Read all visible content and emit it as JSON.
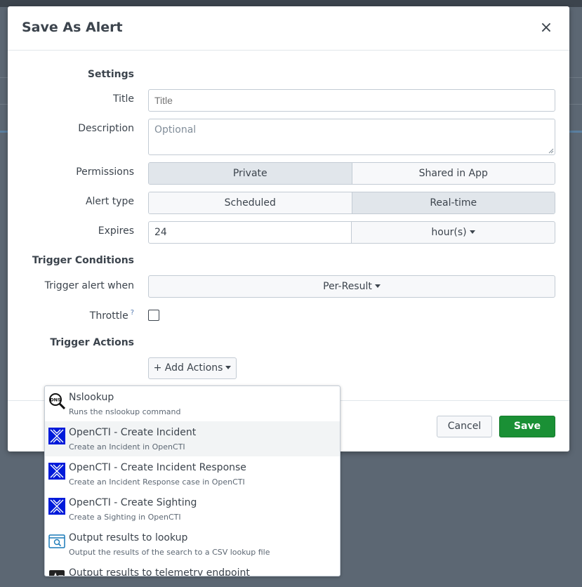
{
  "modal": {
    "title": "Save As Alert",
    "close_label": "×"
  },
  "settings": {
    "heading": "Settings",
    "title_label": "Title",
    "title_placeholder": "Title",
    "description_label": "Description",
    "description_placeholder": "Optional",
    "permissions_label": "Permissions",
    "permissions_options": [
      "Private",
      "Shared in App"
    ],
    "permissions_selected": "Private",
    "alert_type_label": "Alert type",
    "alert_type_options": [
      "Scheduled",
      "Real-time"
    ],
    "alert_type_selected": "Real-time",
    "expires_label": "Expires",
    "expires_value": "24",
    "expires_unit": "hour(s)"
  },
  "trigger_conditions": {
    "heading": "Trigger Conditions",
    "trigger_when_label": "Trigger alert when",
    "trigger_when_value": "Per-Result",
    "throttle_label": "Throttle",
    "throttle_help": "?",
    "throttle_checked": false
  },
  "trigger_actions": {
    "heading": "Trigger Actions",
    "add_actions_label": "+ Add Actions"
  },
  "footer": {
    "cancel_label": "Cancel",
    "save_label": "Save",
    "save_color": "#1a9035"
  },
  "actions_menu": {
    "items": [
      {
        "name": "Nslookup",
        "description": "Runs the nslookup command",
        "icon": "dns-magnifier-icon"
      },
      {
        "name": "OpenCTI - Create Incident",
        "description": "Create an Incident in OpenCTI",
        "icon": "opencti-icon"
      },
      {
        "name": "OpenCTI - Create Incident Response",
        "description": "Create an Incident Response case in OpenCTI",
        "icon": "opencti-icon"
      },
      {
        "name": "OpenCTI - Create Sighting",
        "description": "Create a Sighting in OpenCTI",
        "icon": "opencti-icon"
      },
      {
        "name": "Output results to lookup",
        "description": "Output the results of the search to a CSV lookup file",
        "icon": "lookup-icon"
      },
      {
        "name": "Output results to telemetry endpoint",
        "description": "",
        "icon": "telemetry-icon"
      }
    ],
    "hovered_index": 1,
    "opencti_color": "#001bda"
  }
}
